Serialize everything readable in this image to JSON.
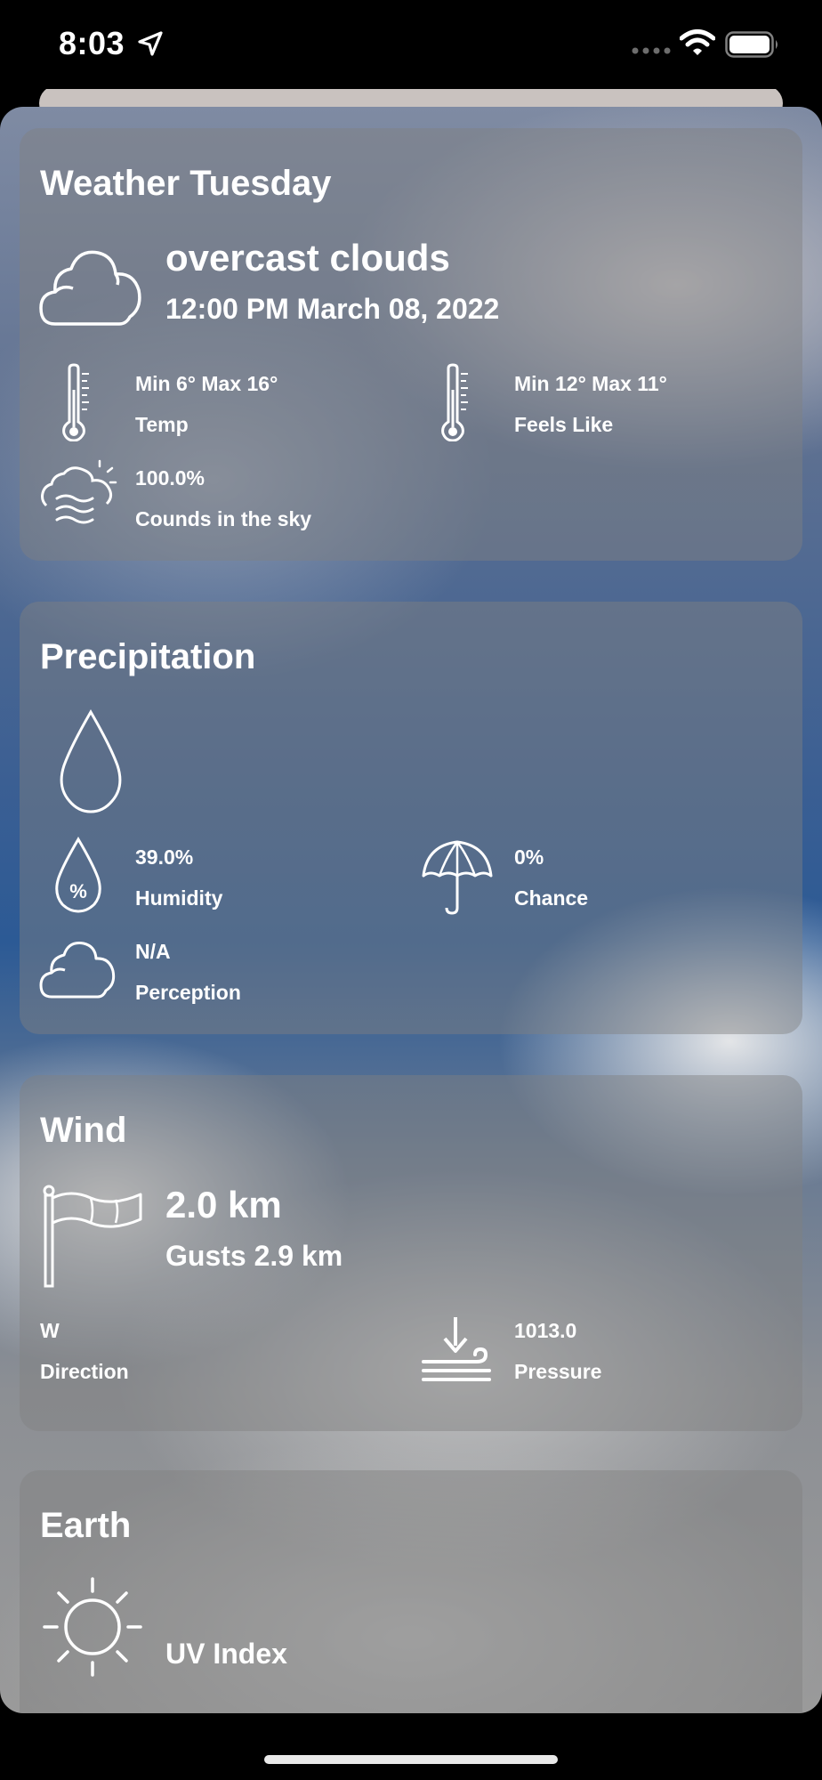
{
  "status_bar": {
    "time": "8:03"
  },
  "weather": {
    "title": "Weather Tuesday",
    "condition": "overcast clouds",
    "datetime": "12:00 PM March 08, 2022",
    "temp": {
      "value": "Min 6° Max 16°",
      "label": "Temp"
    },
    "feels_like": {
      "value": "Min 12° Max 11°",
      "label": "Feels Like"
    },
    "clouds": {
      "value": "100.0%",
      "label": "Counds in the sky"
    }
  },
  "precipitation": {
    "title": "Precipitation",
    "humidity": {
      "value": "39.0%",
      "label": "Humidity"
    },
    "chance": {
      "value": "0%",
      "label": "Chance"
    },
    "perception": {
      "value": "N/A",
      "label": "Perception"
    }
  },
  "wind": {
    "title": "Wind",
    "speed": "2.0 km",
    "gusts": "Gusts 2.9 km",
    "direction": {
      "value": "W",
      "label": "Direction"
    },
    "pressure": {
      "value": "1013.0",
      "label": "Pressure"
    }
  },
  "earth": {
    "title": "Earth",
    "uv_label": "UV Index"
  },
  "icons": {
    "location": "location-arrow-icon",
    "wifi": "wifi-icon",
    "battery": "battery-icon",
    "cloud": "cloud-icon",
    "thermometer": "thermometer-icon",
    "cloudy_night": "cloud-haze-icon",
    "drop": "water-drop-icon",
    "humidity": "humidity-icon",
    "umbrella": "umbrella-icon",
    "flag": "wind-flag-icon",
    "pressure": "pressure-icon",
    "sun": "sun-icon"
  }
}
